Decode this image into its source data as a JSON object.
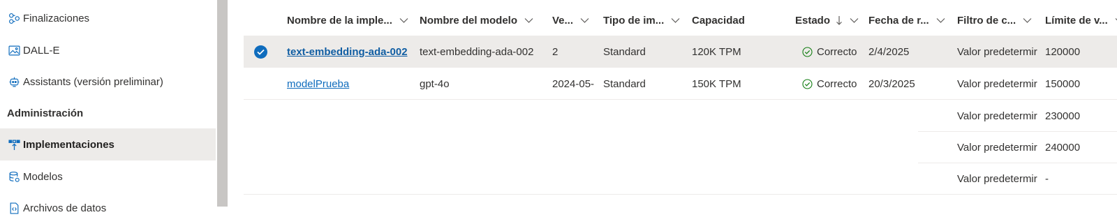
{
  "sidebar": {
    "items": [
      {
        "label": "Finalizaciones",
        "icon": "completions-icon"
      },
      {
        "label": "DALL-E",
        "icon": "image-icon"
      },
      {
        "label": "Assistants (versión preliminar)",
        "icon": "assistant-icon"
      }
    ],
    "section_heading": "Administración",
    "admin_items": [
      {
        "label": "Implementaciones",
        "icon": "deployments-icon",
        "selected": true
      },
      {
        "label": "Modelos",
        "icon": "models-icon"
      },
      {
        "label": "Archivos de datos",
        "icon": "data-files-icon"
      }
    ]
  },
  "table": {
    "headers": [
      "Nombre de la imple...",
      "Nombre del modelo",
      "Ve...",
      "Tipo de im...",
      "Capacidad",
      "Estado",
      "Fecha de r...",
      "Filtro de c...",
      "Límite de v..."
    ],
    "rows": [
      {
        "name": "text-embedding-ada-002",
        "model": "text-embedding-ada-002",
        "version": "2",
        "type": "Standard",
        "capacity": "120K TPM",
        "status": "Correcto",
        "date": "2/4/2025",
        "filter": "Valor predetermir",
        "limit": "120000",
        "selected": true
      },
      {
        "name": "modelPrueba",
        "model": "gpt-4o",
        "version": "2024-05-",
        "type": "Standard",
        "capacity": "150K TPM",
        "status": "Correcto",
        "date": "20/3/2025",
        "filter": "Valor predetermir",
        "limit": "150000"
      },
      {
        "filter": "Valor predetermir",
        "limit": "230000"
      },
      {
        "filter": "Valor predetermir",
        "limit": "240000"
      },
      {
        "filter": "Valor predetermir",
        "limit": "-"
      }
    ]
  },
  "colors": {
    "accent": "#0f6cbd",
    "selected_bg": "#edebe9",
    "success": "#107c10"
  }
}
